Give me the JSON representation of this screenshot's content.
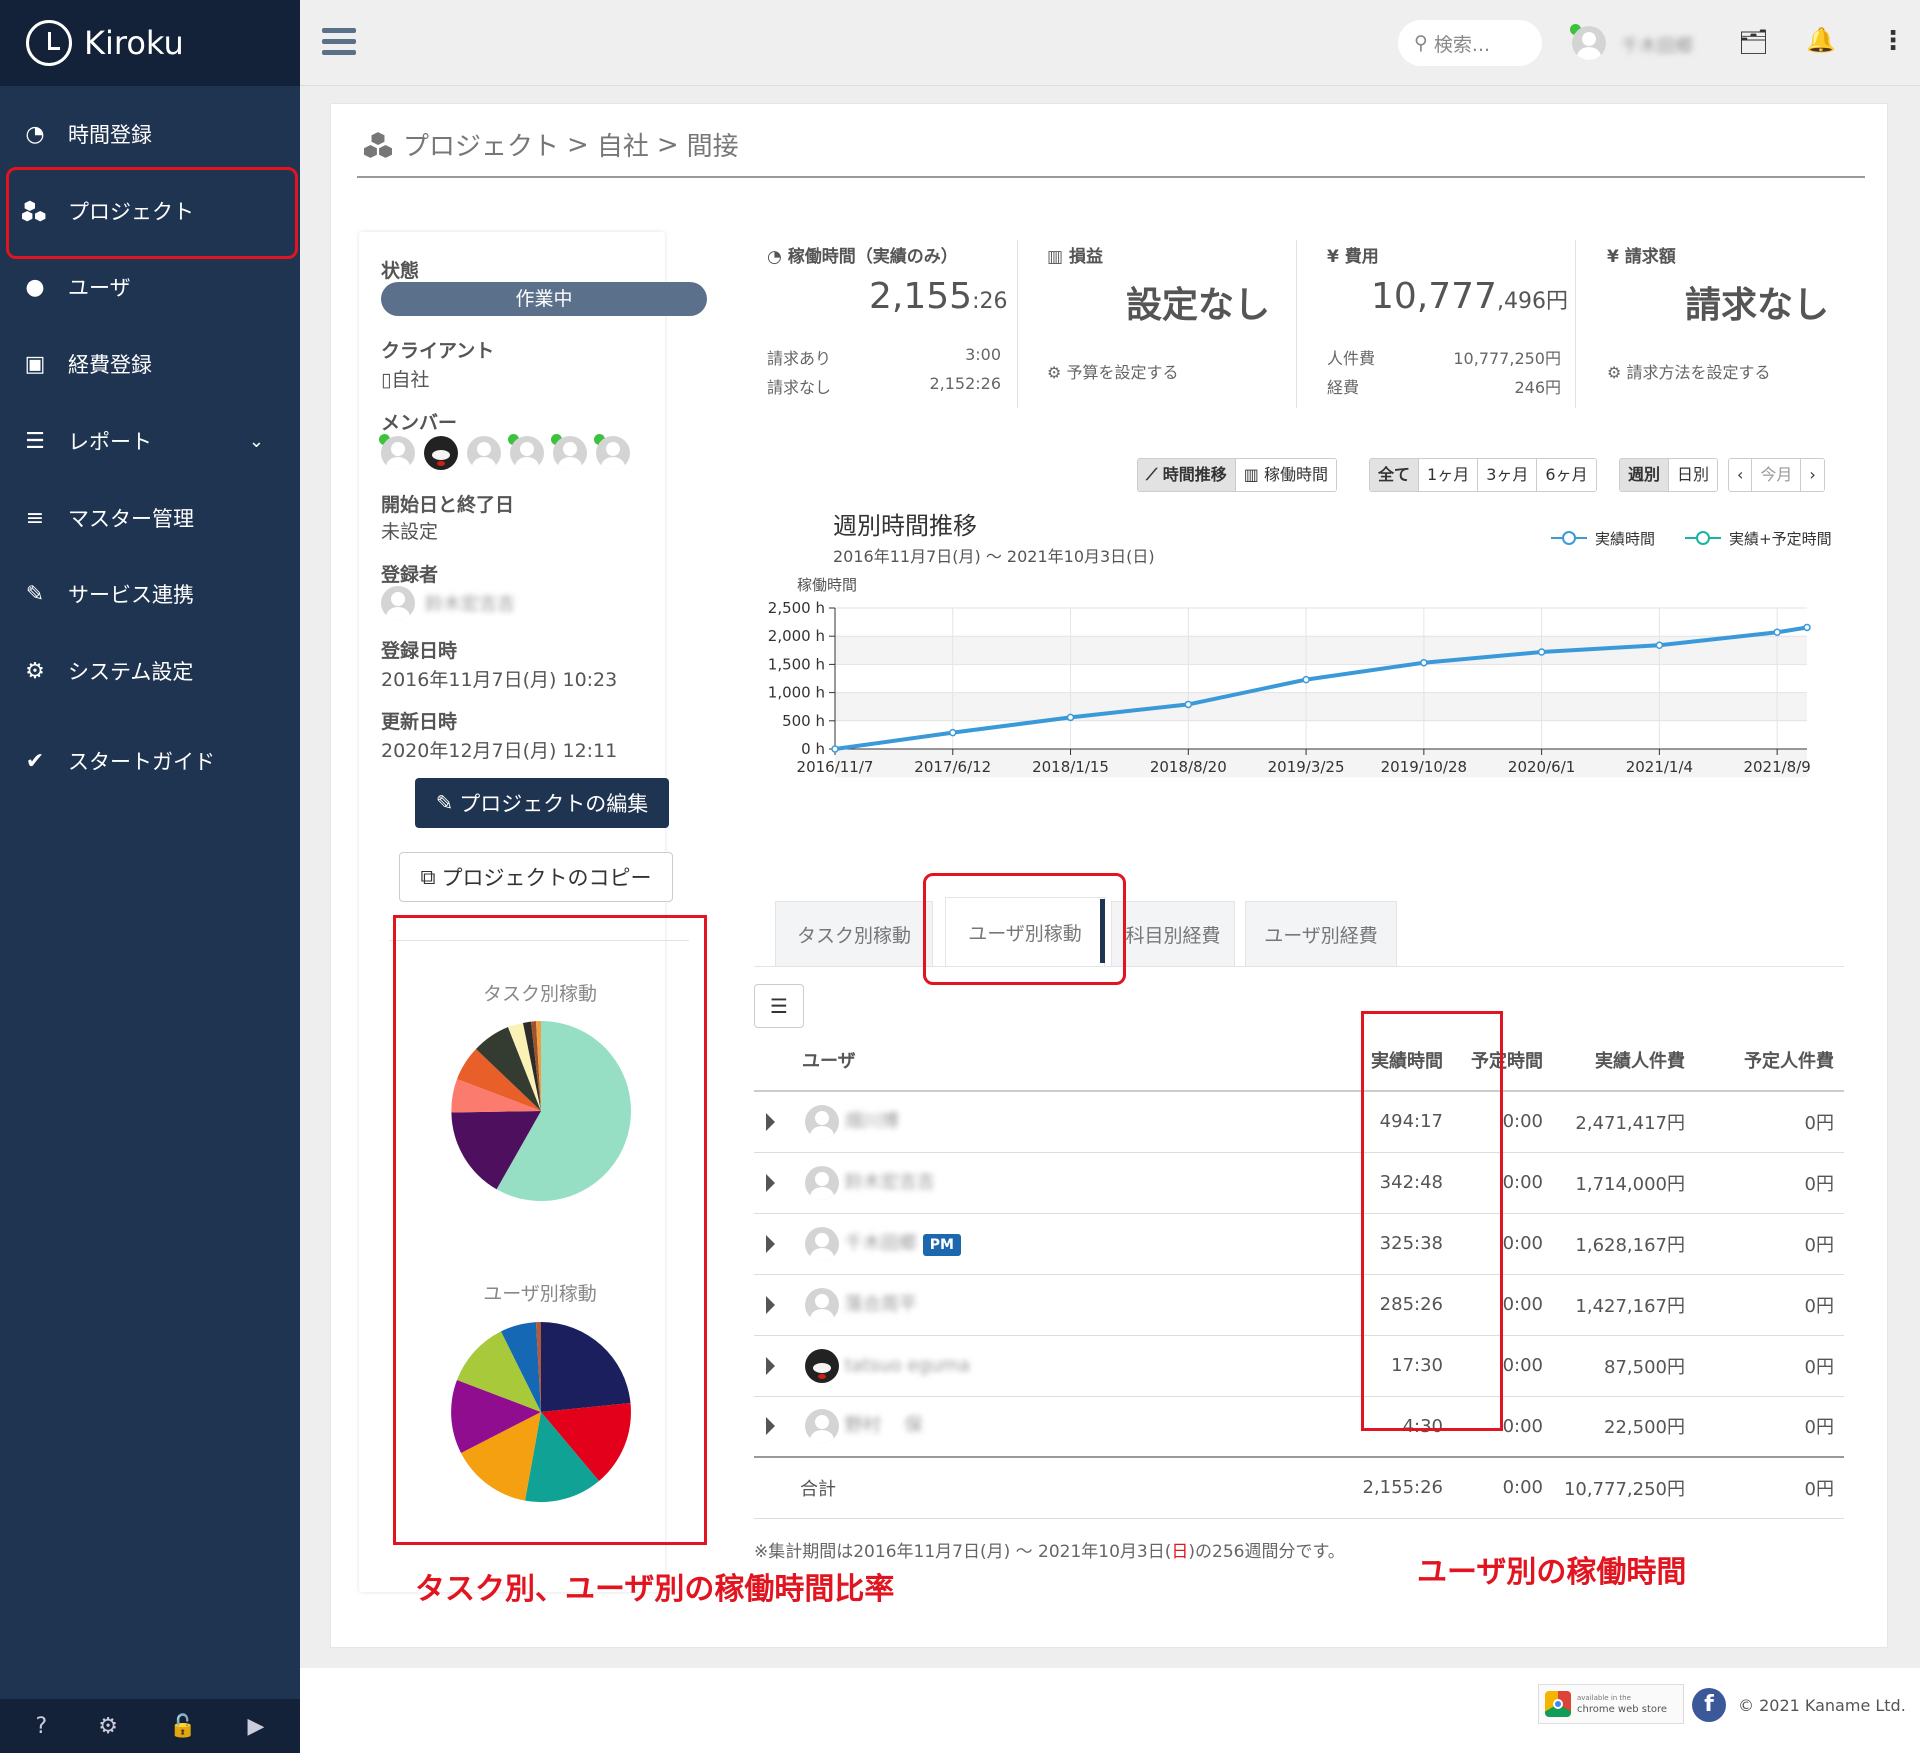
{
  "app": {
    "name": "Kiroku"
  },
  "sidebar": {
    "items": [
      {
        "label": "時間登録",
        "icon": "clock-icon"
      },
      {
        "label": "プロジェクト",
        "icon": "cubes-icon"
      },
      {
        "label": "ユーザ",
        "icon": "user-icon"
      },
      {
        "label": "経費登録",
        "icon": "train-icon"
      },
      {
        "label": "レポート",
        "icon": "list-icon"
      },
      {
        "label": "マスター管理",
        "icon": "database-icon"
      },
      {
        "label": "サービス連携",
        "icon": "plug-icon"
      },
      {
        "label": "システム設定",
        "icon": "gear-icon"
      },
      {
        "label": "スタートガイド",
        "icon": "check-icon"
      }
    ]
  },
  "topbar": {
    "search_placeholder": "検索...",
    "user_name": "千木田郷"
  },
  "breadcrumb": {
    "root": "プロジェクト",
    "sep": ">",
    "c1": "自社",
    "c2": "間接"
  },
  "info": {
    "status_label": "状態",
    "status": "作業中",
    "client_label": "クライアント",
    "client": "自社",
    "member_label": "メンバー",
    "dates_label": "開始日と終了日",
    "dates": "未設定",
    "creator_label": "登録者",
    "creator": "鈴木宏吉吉",
    "created_label": "登録日時",
    "created": "2016年11月7日(月) 10:23",
    "updated_label": "更新日時",
    "updated": "2020年12月7日(月) 12:11",
    "edit_button": "プロジェクトの編集",
    "copy_button": "プロジェクトのコピー"
  },
  "pies": {
    "task_title": "タスク別稼動",
    "user_title": "ユーザ別稼動"
  },
  "stats": {
    "hours_title": "稼働時間（実績のみ）",
    "hours_main": "2,155",
    "hours_sub": ":26",
    "billed_label": "請求あり",
    "billed": "3:00",
    "unbilled_label": "請求なし",
    "unbilled": "2,152:26",
    "pl_title": "損益",
    "pl_main": "設定なし",
    "pl_link": "予算を設定する",
    "cost_title": "費用",
    "cost_main": "10,777",
    "cost_sub": ",496円",
    "labor_label": "人件費",
    "labor": "10,777,250円",
    "expense_label": "経費",
    "expense": "246円",
    "invoice_title": "請求額",
    "invoice_main": "請求なし",
    "invoice_link": "請求方法を設定する"
  },
  "chart_controls": {
    "mode": [
      "時間推移",
      "稼働時間"
    ],
    "range": [
      "全て",
      "1ヶ月",
      "3ヶ月",
      "6ヶ月"
    ],
    "period": [
      "週別",
      "日別"
    ],
    "nav_today": "今月"
  },
  "chart_data": {
    "type": "line",
    "title": "週別時間推移",
    "subtitle": "2016年11月7日(月) 〜 2021年10月3日(日)",
    "ylabel": "稼働時間",
    "ylim": [
      0,
      2500
    ],
    "yticks": [
      "2,500 h",
      "2,000 h",
      "1,500 h",
      "1,000 h",
      "500 h",
      "0 h"
    ],
    "xticks": [
      "2016/11/7",
      "2017/6/12",
      "2018/1/15",
      "2018/8/20",
      "2019/3/25",
      "2019/10/28",
      "2020/6/1",
      "2021/1/4",
      "2021/8/9"
    ],
    "legend": [
      "実績時間",
      "実績+予定時間"
    ],
    "legend_position": "top-right",
    "series": [
      {
        "name": "実績時間",
        "color": "#3a9ad9",
        "x": [
          "2016/11/7",
          "2017/6/12",
          "2018/1/15",
          "2018/8/20",
          "2019/3/25",
          "2019/10/28",
          "2020/6/1",
          "2021/1/4",
          "2021/8/9",
          "2021/10/3"
        ],
        "values": [
          0,
          290,
          560,
          790,
          1230,
          1530,
          1720,
          1840,
          2070,
          2155
        ]
      }
    ]
  },
  "tabs": [
    "タスク別稼動",
    "ユーザ別稼動",
    "科目別経費",
    "ユーザ別経費"
  ],
  "table": {
    "headers": [
      "ユーザ",
      "実績時間",
      "予定時間",
      "実績人件費",
      "予定人件費"
    ],
    "rows": [
      {
        "name": "畑川博",
        "actual": "494:17",
        "planned": "0:00",
        "cost": "2,471,417円",
        "pcost": "0円"
      },
      {
        "name": "鈴木宏吉吉",
        "actual": "342:48",
        "planned": "0:00",
        "cost": "1,714,000円",
        "pcost": "0円"
      },
      {
        "name": "千木田郷",
        "badge": "PM",
        "actual": "325:38",
        "planned": "0:00",
        "cost": "1,628,167円",
        "pcost": "0円"
      },
      {
        "name": "落合周平",
        "actual": "285:26",
        "planned": "0:00",
        "cost": "1,427,167円",
        "pcost": "0円"
      },
      {
        "name": "tatsuo eguma",
        "actual": "17:30",
        "planned": "0:00",
        "cost": "87,500円",
        "pcost": "0円"
      },
      {
        "name": "野村 　保",
        "actual": "4:30",
        "planned": "0:00",
        "cost": "22,500円",
        "pcost": "0円"
      }
    ],
    "total": {
      "label": "合計",
      "actual": "2,155:26",
      "planned": "0:00",
      "cost": "10,777,250円",
      "pcost": "0円"
    },
    "note_pre": "※集計期間は2016年11月7日(月) 〜 2021年10月3日(",
    "note_red": "日",
    "note_post": ")の256週間分です。"
  },
  "annotations": {
    "left": "タスク別、ユーザ別の稼働時間比率",
    "right": "ユーザ別の稼働時間"
  },
  "footer": {
    "copyright": "© 2021 Kaname Ltd.",
    "store_small": "available in the",
    "store_name": "chrome web store"
  }
}
